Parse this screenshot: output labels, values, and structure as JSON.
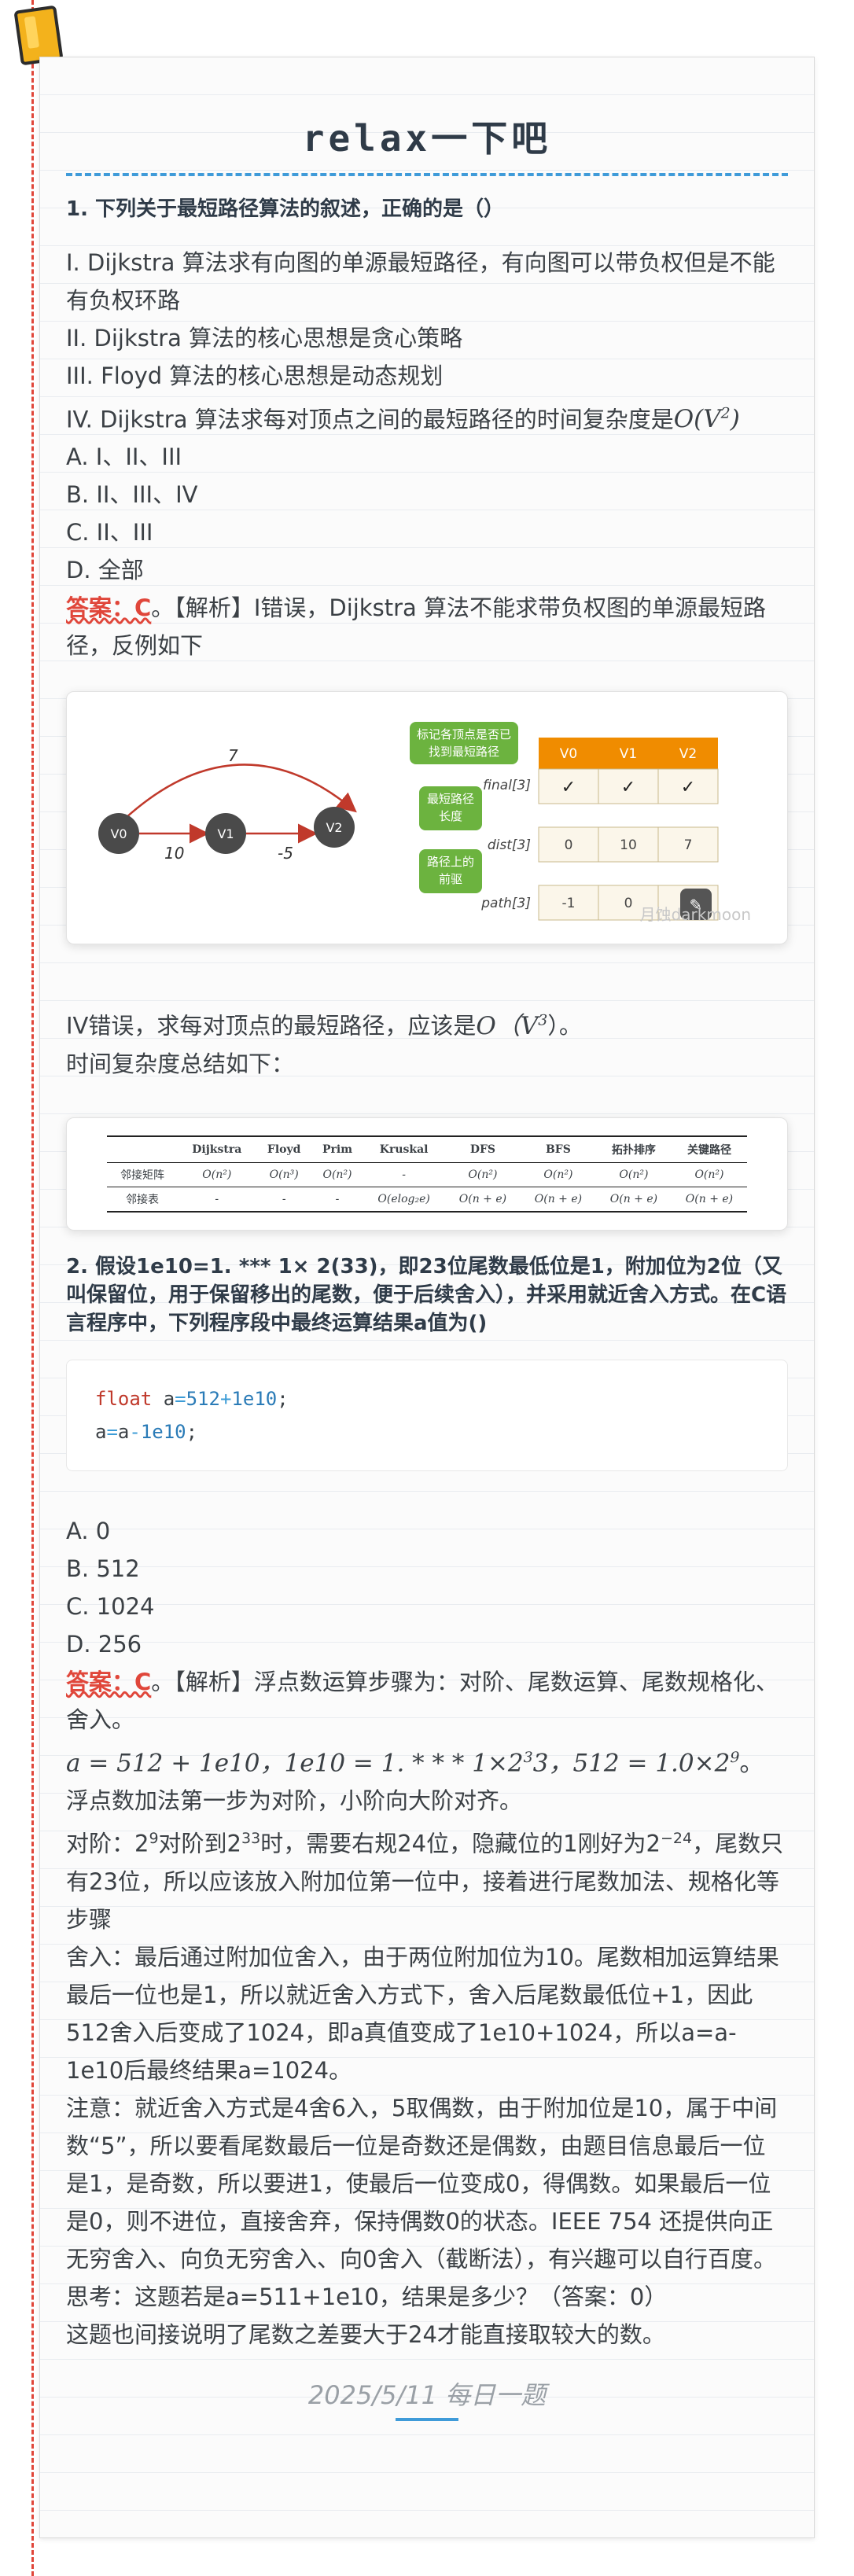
{
  "title": "relax一下吧",
  "q1": {
    "question": "1. 下列关于最短路径算法的叙述，正确的是（）",
    "statements": [
      "I. Dijkstra 算法求有向图的单源最短路径，有向图可以带负权但是不能有负权环路",
      "II. Dijkstra 算法的核心思想是贪心策略",
      "III. Floyd 算法的核心思想是动态规划",
      "IV. Dijkstra 算法求每对顶点之间的最短路径的时间复杂度是"
    ],
    "s4_complexity": "O(V",
    "s4_exp": "2",
    "options": [
      "A. I、II、III",
      "B. II、III、IV",
      "C. II、III",
      "D. 全部"
    ],
    "answer_label": "答案：C",
    "answer_sep": "。",
    "explanation": "【解析】I错误，Dijkstra 算法不能求带负权图的单源最短路径，反例如下",
    "figure": {
      "nodes": [
        "V0",
        "V1",
        "V2"
      ],
      "edges": [
        {
          "from": "V0",
          "to": "V1",
          "weight": "10"
        },
        {
          "from": "V1",
          "to": "V2",
          "weight": "-5"
        },
        {
          "from": "V0",
          "to": "V2",
          "weight": "7"
        }
      ],
      "callouts": [
        "标记各顶点是否已找到最短路径",
        "最短路径长度",
        "路径上的前驱"
      ],
      "columns": [
        "V0",
        "V1",
        "V2"
      ],
      "rows": [
        {
          "label": "final[3]",
          "cells": [
            "✓",
            "✓",
            "✓"
          ]
        },
        {
          "label": "dist[3]",
          "cells": [
            "0",
            "10",
            "7"
          ]
        },
        {
          "label": "path[3]",
          "cells": [
            "-1",
            "0",
            "0"
          ]
        }
      ],
      "watermark": "月蚀darkmoon"
    },
    "iv_text": "IV错误，求每对顶点的最短路径，应该是",
    "iv_complexity": "O（V",
    "iv_exp": "3",
    "iv_end": "）。",
    "summary": "时间复杂度总结如下："
  },
  "complexity_table": {
    "headers": [
      "",
      "Dijkstra",
      "Floyd",
      "Prim",
      "Kruskal",
      "DFS",
      "BFS",
      "拓扑排序",
      "关键路径"
    ],
    "rows": [
      [
        "邻接矩阵",
        "O(n²)",
        "O(n³)",
        "O(n²)",
        "-",
        "O(n²)",
        "O(n²)",
        "O(n²)",
        "O(n²)"
      ],
      [
        "邻接表",
        "-",
        "-",
        "-",
        "O(elog₂e)",
        "O(n + e)",
        "O(n + e)",
        "O(n + e)",
        "O(n + e)"
      ]
    ]
  },
  "q2": {
    "question": "2. 假设1e10=1. *** 1× 2(33)，即23位尾数最低位是1，附加位为2位（又叫保留位，用于保留移出的尾数，便于后续舍入），并采用就近舍入方式。在C语言程序中，下列程序段中最终运算结果a值为()",
    "code_line1": {
      "kw": "float",
      "var": " a",
      "op1": "=",
      "n1": "512",
      "op2": "+",
      "n2": "1e10",
      "end": ";"
    },
    "code_line2": {
      "var": "a",
      "op1": "=",
      "var2": "a",
      "op2": "-",
      "n1": "1e10",
      "end": ";"
    },
    "options": [
      "A. 0",
      "B. 512",
      "C. 1024",
      "D. 256"
    ],
    "answer_label": "答案：C",
    "answer_sep": "。",
    "explanation": "【解析】浮点数运算步骤为：对阶、尾数运算、尾数规格化、舍入。",
    "math_a": "a = 512 + 1e10，1e10 = 1. * * * 1×2",
    "math_a_exp": "3",
    "math_a_mid": "3，512 = 1.0×2",
    "math_a_exp2": "9",
    "math_a_end": "。",
    "p_align": "浮点数加法第一步为对阶，小阶向大阶对齐。",
    "p_dj_a": "对阶：2",
    "p_dj_e1": "9",
    "p_dj_b": "对阶到2",
    "p_dj_e2": "33",
    "p_dj_c": "时，需要右规24位，隐藏位的1刚好为2",
    "p_dj_e3": "−24",
    "p_dj_d": "，尾数只有23位，所以应该放入附加位第一位中，接着进行尾数加法、规格化等步骤",
    "p_round": "舍入：最后通过附加位舍入，由于两位附加位为10。尾数相加运算结果最后一位也是1，所以就近舍入方式下，舍入后尾数最低位+1，因此512舍入后变成了1024，即a真值变成了1e10+1024，所以a=a-1e10后最终结果a=1024。",
    "p_note": "注意：就近舍入方式是4舍6入，5取偶数，由于附加位是10，属于中间数“5”，所以要看尾数最后一位是奇数还是偶数，由题目信息最后一位是1，是奇数，所以要进1，使最后一位变成0，得偶数。如果最后一位是0，则不进位，直接舍弃，保持偶数0的状态。IEEE 754 还提供向正无穷舍入、向负无穷舍入、向0舍入（截断法），有兴趣可以自行百度。",
    "p_think": "思考：这题若是a=511+1e10，结果是多少？（答案：0）",
    "p_last": "这题也间接说明了尾数之差要大于24才能直接取较大的数。"
  },
  "footer": "2025/5/11 每日一题",
  "colors": {
    "accent": "#3f9bd9",
    "answer": "#e0463a",
    "table_header": "#f08c00",
    "callout": "#6cb33f",
    "node": "#4a4a4a",
    "arrow": "#c0392b"
  }
}
